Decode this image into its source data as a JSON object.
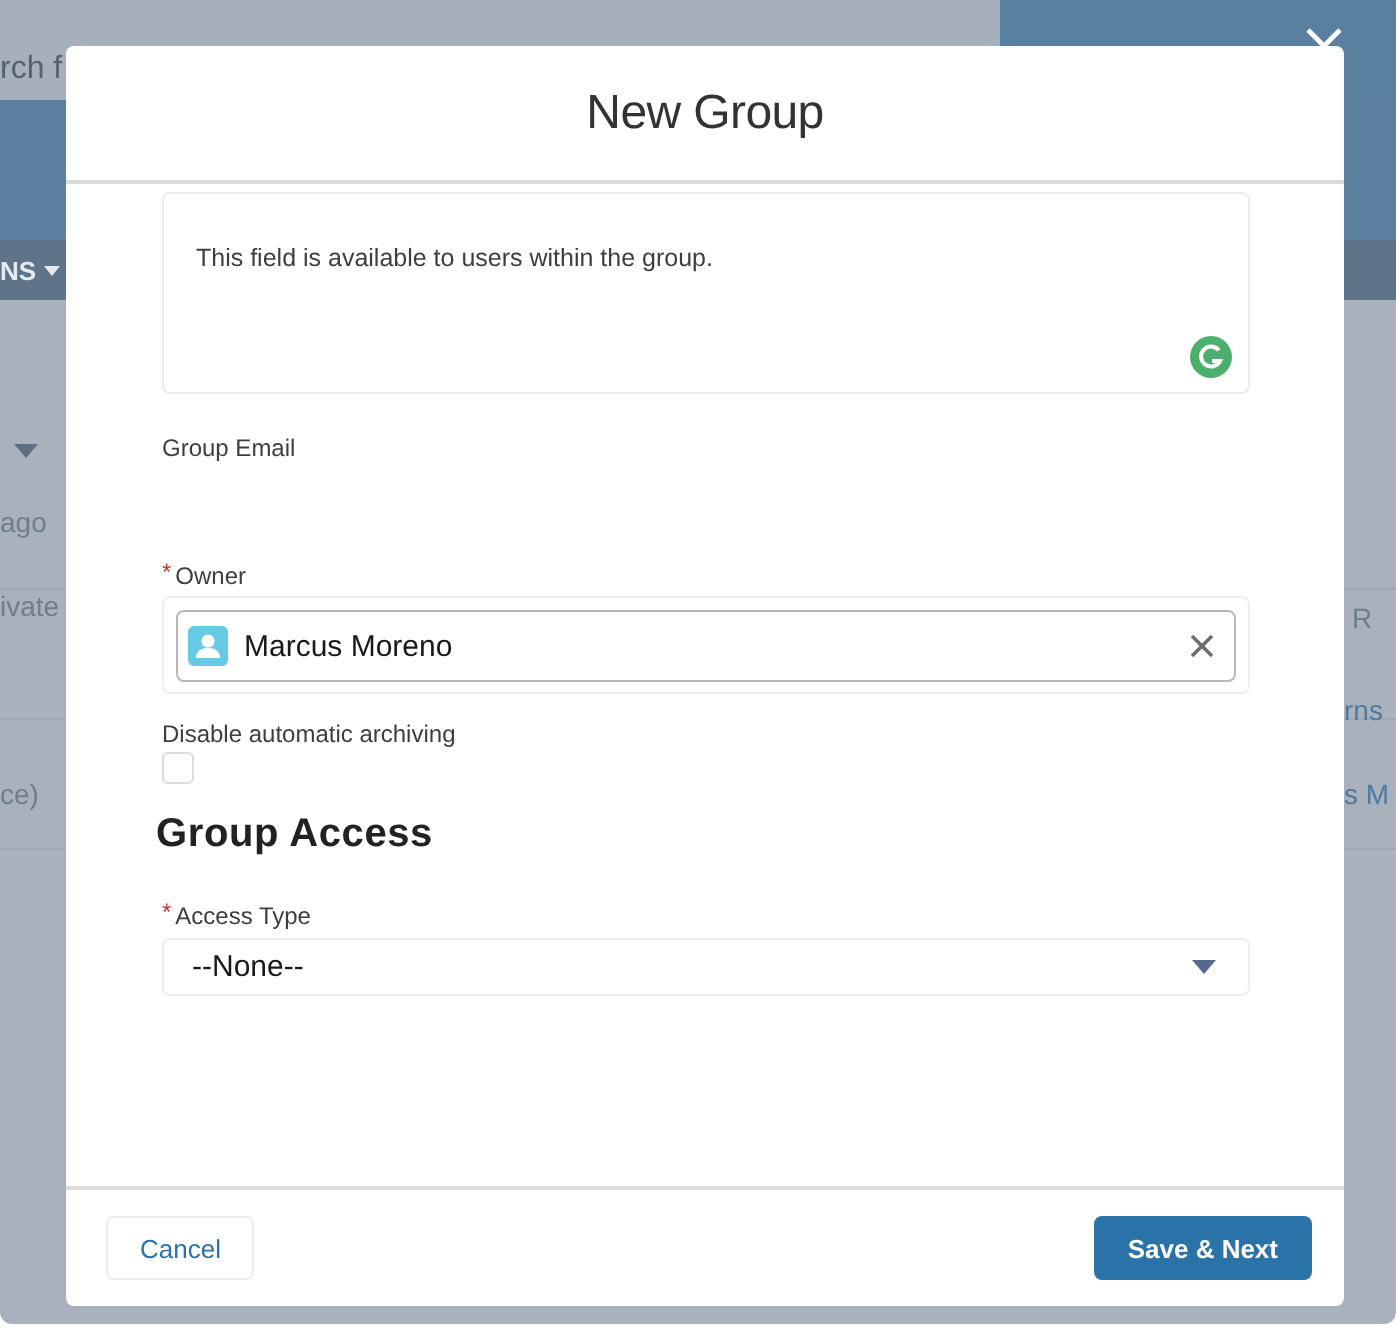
{
  "background": {
    "search": {
      "placeholder": "rch f"
    },
    "nav_tab": "NS",
    "left_fragments": [
      "ago",
      "ivate",
      "ce)"
    ],
    "right_fragments": [
      "R",
      "rns",
      "s M"
    ]
  },
  "dialog": {
    "title": "New Group",
    "description_field": {
      "value": "This field is available to users within the group."
    },
    "group_email": {
      "label": "Group Email"
    },
    "owner": {
      "required_mark": "*",
      "label": "Owner",
      "value": "Marcus Moreno"
    },
    "disable_archiving": {
      "label": "Disable automatic archiving",
      "checked": false
    },
    "section_heading": "Group Access",
    "access_type": {
      "required_mark": "*",
      "label": "Access Type",
      "value": "--None--"
    },
    "buttons": [
      {
        "label": "Cancel",
        "kind": "neutral"
      },
      {
        "label": "Save & Next",
        "kind": "brand"
      }
    ]
  }
}
